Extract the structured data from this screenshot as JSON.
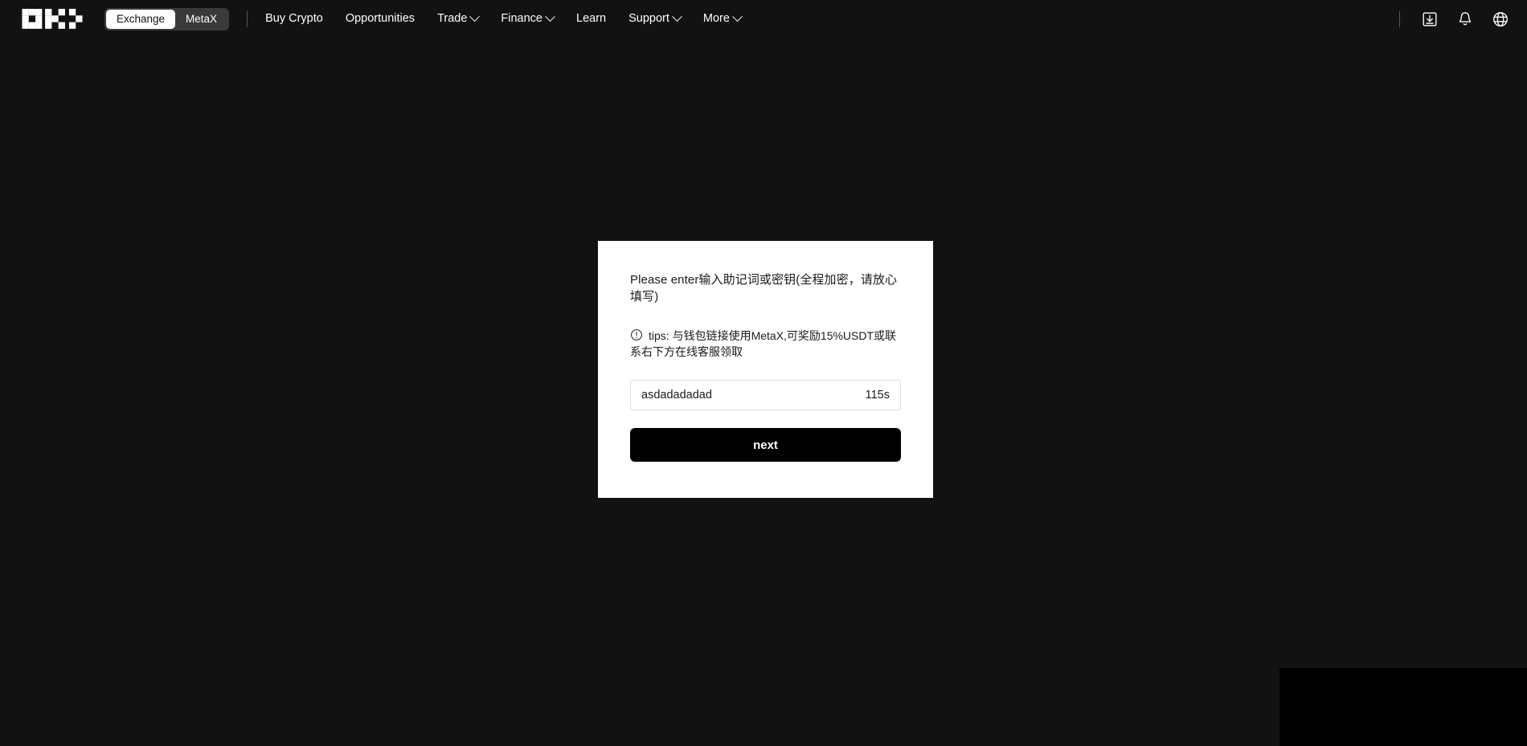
{
  "header": {
    "logo_name": "okx-logo",
    "segmented": {
      "items": [
        {
          "label": "Exchange",
          "active": true
        },
        {
          "label": "MetaX",
          "active": false
        }
      ]
    },
    "nav": [
      {
        "label": "Buy Crypto",
        "caret": false
      },
      {
        "label": "Opportunities",
        "caret": false
      },
      {
        "label": "Trade",
        "caret": true
      },
      {
        "label": "Finance",
        "caret": true
      },
      {
        "label": "Learn",
        "caret": false
      },
      {
        "label": "Support",
        "caret": true
      },
      {
        "label": "More",
        "caret": true
      }
    ],
    "icons": [
      {
        "name": "download-icon"
      },
      {
        "name": "bell-icon"
      },
      {
        "name": "globe-icon"
      }
    ]
  },
  "modal": {
    "title": "Please enter输入助记词或密钥(全程加密，请放心填写)",
    "tips_icon": "warning-circle-icon",
    "tips": "tips: 与钱包链接使用MetaX,可奖励15%USDT或联系右下方在线客服领取",
    "input": {
      "value": "asdadadadad",
      "placeholder": ""
    },
    "timer": "115s",
    "submit_label": "next"
  },
  "colors": {
    "page_background": "#121212",
    "modal_background": "#ffffff",
    "button_background": "#000000",
    "text_light": "#ffffff",
    "text_dark": "#1a1a1a",
    "segment_track": "#3a3a3a",
    "input_border": "#dcdcdc",
    "corner_panel": "#000000"
  }
}
